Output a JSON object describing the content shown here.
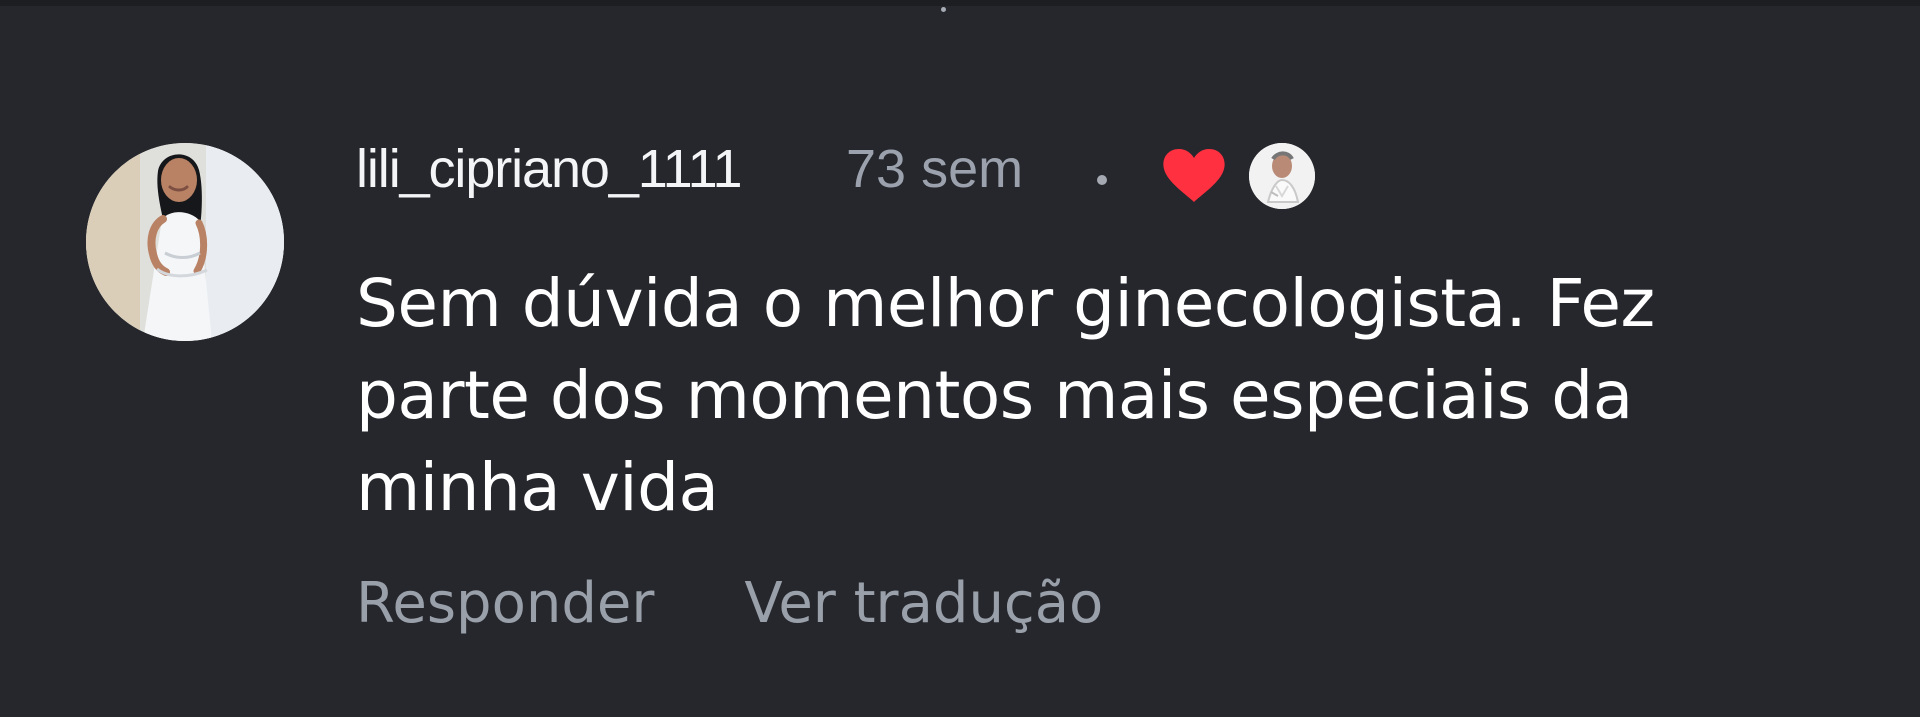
{
  "comment": {
    "username": "lili_cipriano_1111",
    "time_ago": "73 sem",
    "text": "Sem dúvida o melhor ginecologista. Fez parte dos momentos mais especiais da minha vida",
    "liked": true
  },
  "actions": {
    "reply_label": "Responder",
    "translate_label": "Ver tradução"
  },
  "icons": {
    "like": "heart-icon",
    "meta_separator": "dot-icon"
  },
  "colors": {
    "background": "#25272c",
    "primary_text": "#ffffff",
    "secondary_text": "#9ca2ad",
    "heart": "#ff3040"
  }
}
